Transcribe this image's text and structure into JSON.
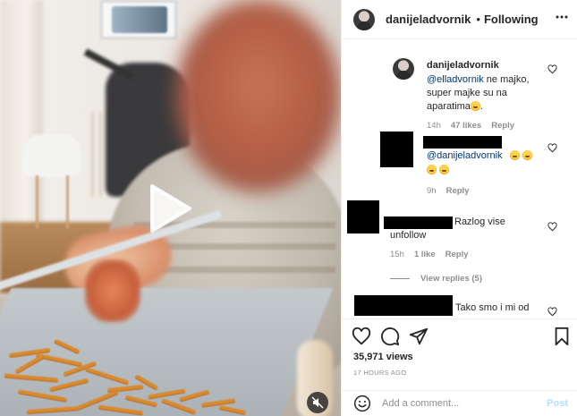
{
  "header": {
    "username": "danijeladvornik",
    "separator": "•",
    "follow_status": "Following"
  },
  "comments": [
    {
      "username": "danijeladvornik",
      "mention": "@elladvornik",
      "text": " ne majko, super majke su na aparatima",
      "emoji": "laughing-face",
      "trailing": ".",
      "age": "14h",
      "likes": "47 likes",
      "reply": "Reply",
      "author_visible": true
    },
    {
      "username": "",
      "mention": "@danijeladvornik",
      "text": "",
      "emoji": "rolling-laughing-face",
      "age": "9h",
      "reply": "Reply",
      "author_visible": false
    },
    {
      "username": "",
      "text": "Razlog vise",
      "text_line2": "unfollow",
      "age": "15h",
      "likes": "1 like",
      "reply": "Reply",
      "author_visible": false
    },
    {
      "username": "",
      "text": "Tako smo i mi od",
      "author_visible": false
    }
  ],
  "view_replies": "View replies (5)",
  "stats": {
    "views": "35,971 views",
    "posted": "17 HOURS AGO"
  },
  "composer": {
    "placeholder": "Add a comment...",
    "post_label": "Post"
  },
  "icons": {
    "play": "play-icon",
    "mute": "muted-speaker-icon",
    "more": "more-options-icon",
    "like": "heart-icon",
    "comment": "comment-bubble-icon",
    "share": "paper-plane-icon",
    "save": "bookmark-icon",
    "emoji": "smiley-icon"
  },
  "colors": {
    "mention": "#00376b",
    "muted_text": "#8e8e8e",
    "post_disabled": "#b2dffc",
    "divider": "#efefef"
  }
}
